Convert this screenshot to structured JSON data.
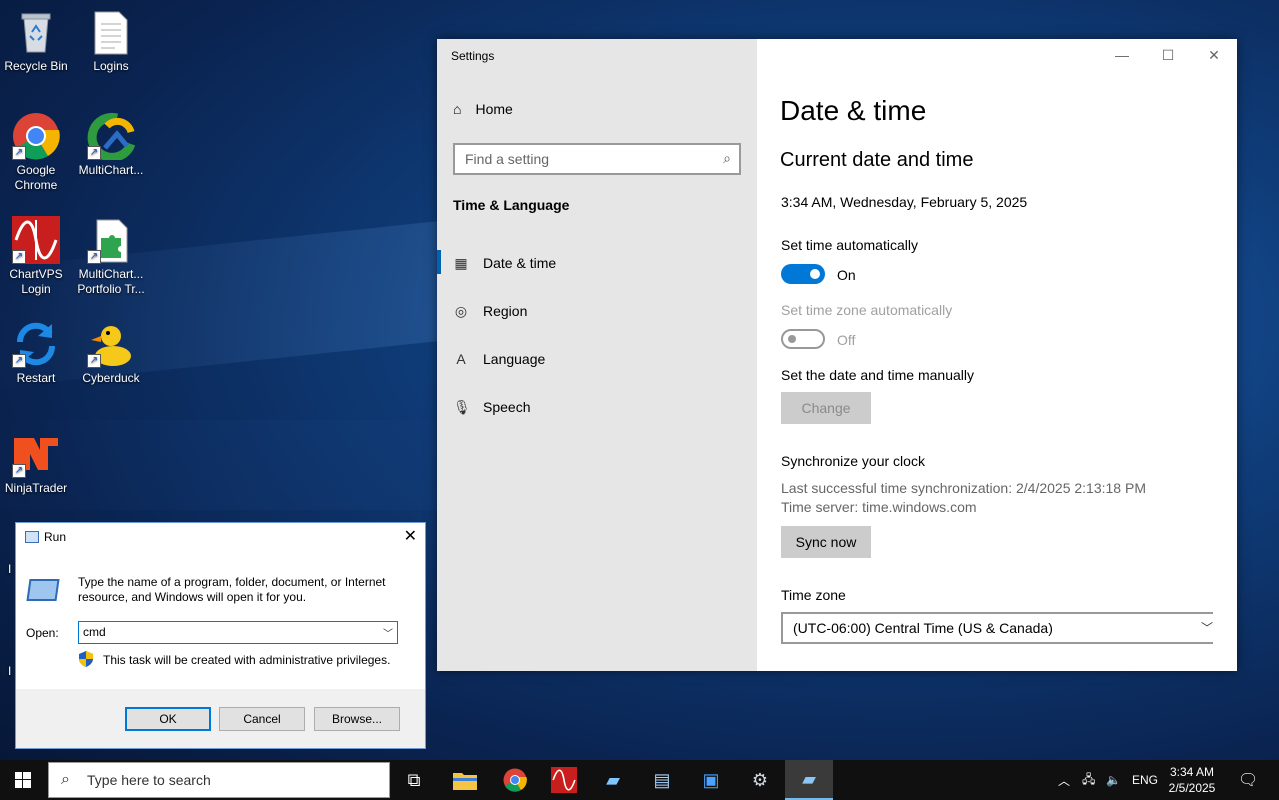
{
  "desktop": {
    "icons": [
      {
        "label": "Recycle Bin"
      },
      {
        "label": "Logins"
      },
      {
        "label": "Google Chrome"
      },
      {
        "label": "MultiChart..."
      },
      {
        "label": "ChartVPS Login"
      },
      {
        "label": "MultiChart... Portfolio Tr..."
      },
      {
        "label": "Restart"
      },
      {
        "label": "Cyberduck"
      },
      {
        "label": "NinjaTrader"
      }
    ]
  },
  "settings": {
    "window_title": "Settings",
    "nav": {
      "home": "Home",
      "search_placeholder": "Find a setting",
      "section": "Time & Language",
      "items": [
        {
          "label": "Date & time"
        },
        {
          "label": "Region"
        },
        {
          "label": "Language"
        },
        {
          "label": "Speech"
        }
      ]
    },
    "content": {
      "page_title": "Date & time",
      "section_title": "Current date and time",
      "current_datetime": "3:34 AM, Wednesday, February 5, 2025",
      "auto_time_label": "Set time automatically",
      "auto_time_state": "On",
      "auto_tz_label": "Set time zone automatically",
      "auto_tz_state": "Off",
      "manual_label": "Set the date and time manually",
      "change_button": "Change",
      "sync_title": "Synchronize your clock",
      "last_sync": "Last successful time synchronization: 2/4/2025 2:13:18 PM",
      "time_server": "Time server: time.windows.com",
      "sync_button": "Sync now",
      "tz_label": "Time zone",
      "tz_value": "(UTC-06:00) Central Time (US & Canada)"
    }
  },
  "run_dialog": {
    "title": "Run",
    "description": "Type the name of a program, folder, document, or Internet resource, and Windows will open it for you.",
    "open_label": "Open:",
    "open_value": "cmd",
    "admin_note": "This task will be created with administrative privileges.",
    "ok": "OK",
    "cancel": "Cancel",
    "browse": "Browse..."
  },
  "taskbar": {
    "search_placeholder": "Type here to search",
    "language": "ENG",
    "time": "3:34 AM",
    "date": "2/5/2025"
  }
}
